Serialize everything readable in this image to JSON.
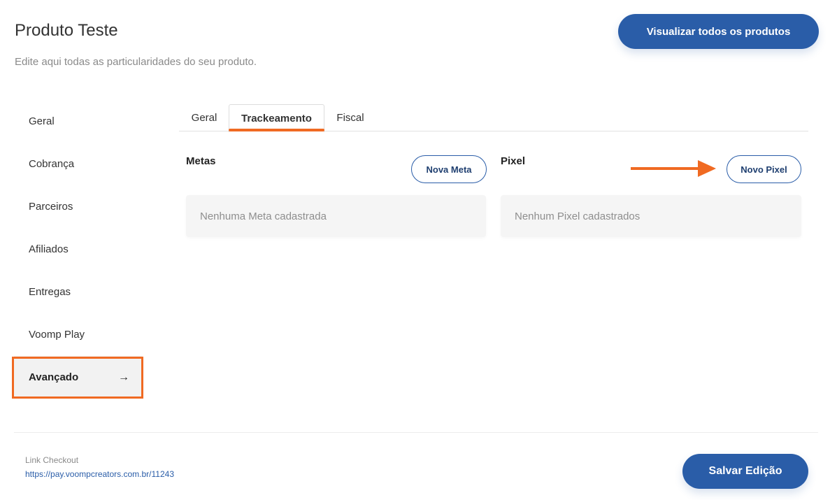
{
  "header": {
    "title": "Produto Teste",
    "subtitle": "Edite aqui todas as particularidades do seu produto.",
    "view_all_label": "Visualizar todos os produtos"
  },
  "sidebar": {
    "items": [
      {
        "label": "Geral"
      },
      {
        "label": "Cobrança"
      },
      {
        "label": "Parceiros"
      },
      {
        "label": "Afiliados"
      },
      {
        "label": "Entregas"
      },
      {
        "label": "Voomp Play"
      },
      {
        "label": "Avançado",
        "active": true,
        "arrow": "→"
      }
    ]
  },
  "tabs": [
    {
      "label": "Geral"
    },
    {
      "label": "Trackeamento",
      "active": true
    },
    {
      "label": "Fiscal"
    }
  ],
  "metas": {
    "title": "Metas",
    "add_label": "Nova Meta",
    "empty_text": "Nenhuma Meta cadastrada"
  },
  "pixel": {
    "title": "Pixel",
    "add_label": "Novo Pixel",
    "empty_text": "Nenhum Pixel cadastrados"
  },
  "footer": {
    "link_label": "Link Checkout",
    "link_url": "https://pay.voompcreators.com.br/11243",
    "save_label": "Salvar Edição"
  },
  "colors": {
    "primary": "#2a5da8",
    "accent_orange": "#f06a22",
    "active_bg": "#f2f2f2"
  },
  "icons": {
    "sidebar_active_arrow": "arrow-right-icon",
    "annotation": "annotation-arrow-icon"
  }
}
